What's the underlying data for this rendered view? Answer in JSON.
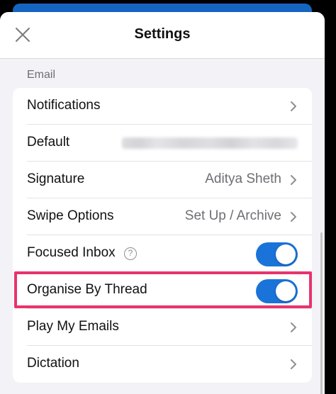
{
  "header": {
    "title": "Settings",
    "close_icon": "close-icon"
  },
  "section": {
    "label": "Email"
  },
  "rows": {
    "notifications": {
      "label": "Notifications"
    },
    "default": {
      "label": "Default"
    },
    "signature": {
      "label": "Signature",
      "value": "Aditya Sheth"
    },
    "swipe": {
      "label": "Swipe Options",
      "value": "Set Up / Archive"
    },
    "focused": {
      "label": "Focused Inbox",
      "help_glyph": "?",
      "toggle_on": true
    },
    "thread": {
      "label": "Organise By Thread",
      "toggle_on": true
    },
    "play": {
      "label": "Play My Emails"
    },
    "dictation": {
      "label": "Dictation"
    }
  },
  "colors": {
    "toggle_on": "#1a73d9",
    "highlight": "#e8336d",
    "top_bar": "#1565c0"
  }
}
